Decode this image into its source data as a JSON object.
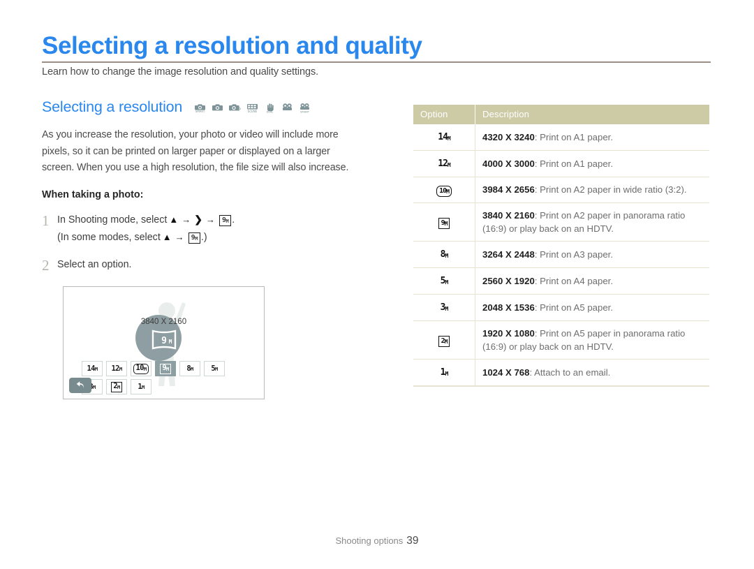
{
  "page": {
    "title": "Selecting a resolution and quality",
    "subtitle": "Learn how to change the image resolution and quality settings.",
    "accent_color": "#2a87ee",
    "rule_color": "#9a8d84"
  },
  "section": {
    "heading": "Selecting a resolution",
    "mode_icons": [
      "smart-auto-camera-icon",
      "program-camera-icon",
      "aperture-priority-camera-icon",
      "scene-mode-icon",
      "dual-is-hand-icon",
      "movie-camera-icon",
      "smart-movie-camera-icon"
    ],
    "intro": "As you increase the resolution, your photo or video will include more pixels, so it can be printed on larger paper or displayed on a larger screen. When you use a high resolution, the file size will also increase.",
    "photo_label": "When taking a photo:"
  },
  "steps": [
    {
      "num": "1",
      "line1_a": "In Shooting mode, select",
      "line1_badge": "9",
      "line1_badge_sub": "M",
      "line1_end": ".",
      "line2_a": "(In some modes, select",
      "line2_badge": "9",
      "line2_badge_sub": "M",
      "line2_end": ".)"
    },
    {
      "num": "2",
      "text": "Select an option."
    }
  ],
  "camera_screen": {
    "center_resolution_text": "3840 X 2160",
    "center_badge": "9",
    "center_badge_sub": "M",
    "circle_color": "#84969a",
    "back_button": "back-icon",
    "options_row1": [
      {
        "label": "14",
        "sub": "M",
        "style": "plain",
        "selected": false
      },
      {
        "label": "12",
        "sub": "M",
        "style": "plain",
        "selected": false
      },
      {
        "label": "10",
        "sub": "M",
        "style": "rounded",
        "selected": false
      },
      {
        "label": "9",
        "sub": "M",
        "style": "boxed",
        "selected": true
      },
      {
        "label": "8",
        "sub": "M",
        "style": "plain",
        "selected": false
      },
      {
        "label": "5",
        "sub": "M",
        "style": "plain",
        "selected": false
      }
    ],
    "options_row2": [
      {
        "label": "3",
        "sub": "M",
        "style": "plain",
        "selected": false
      },
      {
        "label": "2",
        "sub": "M",
        "style": "boxed",
        "selected": false
      },
      {
        "label": "1",
        "sub": "M",
        "style": "plain",
        "selected": false
      }
    ]
  },
  "table": {
    "header_bg": "#cdcaa6",
    "columns": [
      "Option",
      "Description"
    ],
    "rows": [
      {
        "icon": "14",
        "icon_sub": "M",
        "icon_style": "plain",
        "dimensions": "4320 X 3240",
        "description": ": Print on A1 paper."
      },
      {
        "icon": "12",
        "icon_sub": "M",
        "icon_style": "plain",
        "dimensions": "4000 X 3000",
        "description": ": Print on A1 paper."
      },
      {
        "icon": "10",
        "icon_sub": "M",
        "icon_style": "rounded",
        "dimensions": "3984 X 2656",
        "description": ": Print on A2 paper in wide ratio (3:2)."
      },
      {
        "icon": "9",
        "icon_sub": "M",
        "icon_style": "boxed",
        "dimensions": "3840 X 2160",
        "description": ": Print on A2 paper in panorama ratio (16:9) or play back on an HDTV."
      },
      {
        "icon": "8",
        "icon_sub": "M",
        "icon_style": "plain",
        "dimensions": "3264 X 2448",
        "description": ": Print on A3 paper."
      },
      {
        "icon": "5",
        "icon_sub": "M",
        "icon_style": "plain",
        "dimensions": "2560 X 1920",
        "description": ": Print on A4 paper."
      },
      {
        "icon": "3",
        "icon_sub": "M",
        "icon_style": "plain",
        "dimensions": "2048 X 1536",
        "description": ": Print on A5 paper."
      },
      {
        "icon": "2",
        "icon_sub": "M",
        "icon_style": "boxed",
        "dimensions": "1920 X 1080",
        "description": ": Print on A5 paper in panorama ratio (16:9) or play back on an HDTV."
      },
      {
        "icon": "1",
        "icon_sub": "M",
        "icon_style": "plain",
        "dimensions": "1024 X 768",
        "description": ": Attach to an email."
      }
    ]
  },
  "footer": {
    "label": "Shooting options",
    "page_number": "39"
  }
}
